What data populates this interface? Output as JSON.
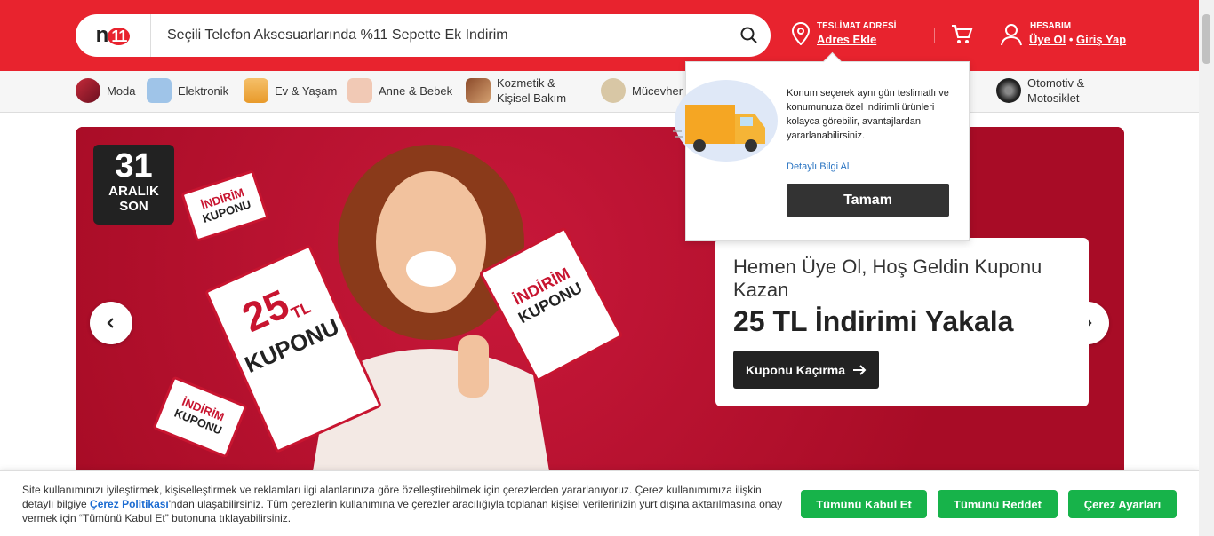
{
  "header": {
    "logo_text": "n11",
    "search_placeholder": "Seçili Telefon Aksesuarlarında %11 Sepette Ek İndirim",
    "delivery_label": "TESLİMAT ADRESİ",
    "delivery_link": "Adres Ekle",
    "account_label": "HESABIM",
    "register_link": "Üye Ol",
    "login_link": "Giriş Yap",
    "brand_color": "#e8232e"
  },
  "categories": [
    {
      "label": "Moda",
      "icon": "fashion-icon"
    },
    {
      "label": "Elektronik",
      "icon": "electronics-icon"
    },
    {
      "label": "Ev & Yaşam",
      "icon": "home-icon"
    },
    {
      "label": "Anne & Bebek",
      "icon": "baby-icon"
    },
    {
      "label": "Kozmetik &",
      "label2": "Kişisel Bakım",
      "icon": "cosmetics-icon"
    },
    {
      "label": "Mücevher",
      "icon": "jewelry-icon"
    },
    {
      "label": "Otomotiv &",
      "label2": "Motosiklet",
      "icon": "automotive-icon"
    }
  ],
  "banner": {
    "badge_number": "31",
    "badge_line1": "ARALIK",
    "badge_line2": "SON",
    "coupon_small_1": "İNDİRİM",
    "coupon_small_2": "KUPONU",
    "coupon_big_amount": "25",
    "coupon_big_currency": "TL",
    "coupon_big_label": "KUPONU",
    "promo_subtitle": "Hemen Üye Ol, Hoş Geldin Kuponu Kazan",
    "promo_title": "25 TL İndirimi Yakala",
    "promo_button": "Kuponu Kaçırma",
    "banner_color": "#b8102a"
  },
  "location_popup": {
    "text": "Konum seçerek aynı gün teslimatlı ve konumunuza özel indirimli ürünleri kolayca görebilir, avantajlardan yararlanabilirsiniz.",
    "link": "Detaylı Bilgi Al",
    "button": "Tamam"
  },
  "cookie_banner": {
    "text_before": "Site kullanımınızı iyileştirmek, kişiselleştirmek ve reklamları ilgi alanlarınıza göre özelleştirebilmek için çerezlerden yararlanıyoruz. Çerez kullanımımıza ilişkin detaylı bilgiye ",
    "policy_link": "Çerez Politikası",
    "text_after": "'ndan ulaşabilirsiniz. Tüm çerezlerin kullanımına ve çerezler aracılığıyla toplanan kişisel verilerinizin yurt dışına aktarılmasına onay vermek için “Tümünü Kabul Et” butonuna tıklayabilirsiniz.",
    "accept_all": "Tümünü Kabul Et",
    "reject_all": "Tümünü Reddet",
    "settings": "Çerez Ayarları",
    "button_color": "#17b34a"
  }
}
